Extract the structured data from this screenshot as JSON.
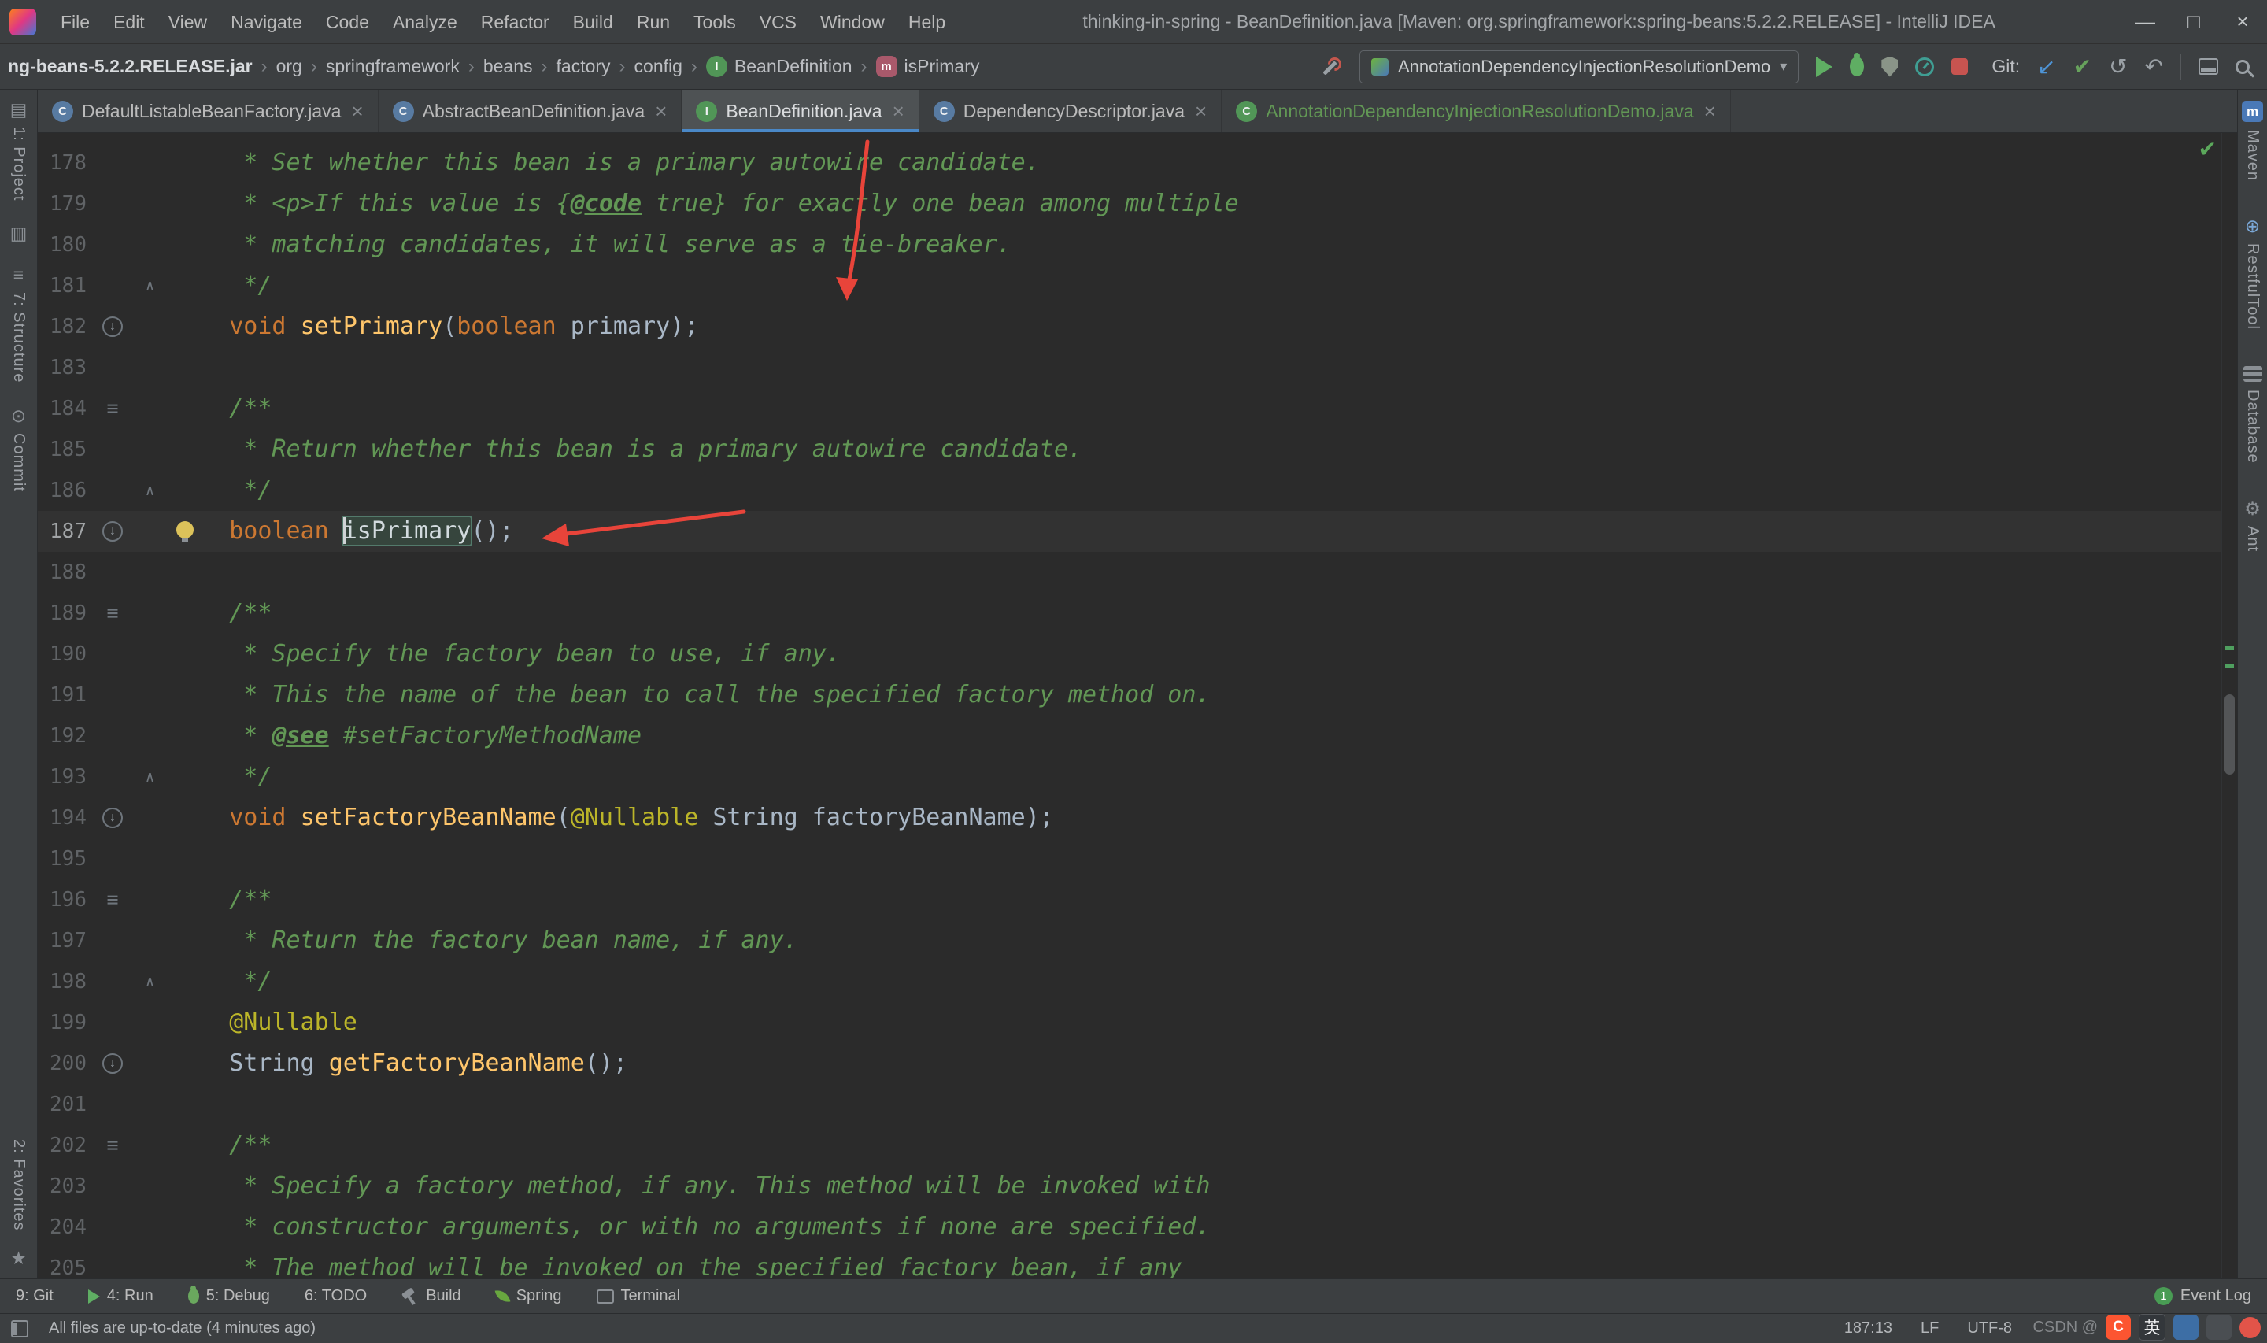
{
  "window": {
    "title": "thinking-in-spring - BeanDefinition.java [Maven: org.springframework:spring-beans:5.2.2.RELEASE] - IntelliJ IDEA",
    "menus": [
      "File",
      "Edit",
      "View",
      "Navigate",
      "Code",
      "Analyze",
      "Refactor",
      "Build",
      "Run",
      "Tools",
      "VCS",
      "Window",
      "Help"
    ],
    "controls": {
      "minimize": "—",
      "maximize": "□",
      "close": "×"
    }
  },
  "navbar": {
    "separator": "›",
    "crumbs": [
      {
        "label": "ng-beans-5.2.2.RELEASE.jar",
        "bold": true
      },
      {
        "label": "org"
      },
      {
        "label": "springframework"
      },
      {
        "label": "beans"
      },
      {
        "label": "factory"
      },
      {
        "label": "config"
      },
      {
        "label": "BeanDefinition",
        "icon": "interface"
      },
      {
        "label": "isPrimary",
        "icon": "method"
      }
    ],
    "run_config": "AnnotationDependencyInjectionResolutionDemo",
    "git_label": "Git:"
  },
  "tabbar": {
    "tabs": [
      {
        "label": "DefaultListableBeanFactory.java",
        "icon": "class"
      },
      {
        "label": "AbstractBeanDefinition.java",
        "icon": "class"
      },
      {
        "label": "BeanDefinition.java",
        "icon": "interface",
        "active": true
      },
      {
        "label": "DependencyDescriptor.java",
        "icon": "class"
      },
      {
        "label": "AnnotationDependencyInjectionResolutionDemo.java",
        "icon": "class",
        "vcs_new": true
      }
    ]
  },
  "left_strip": {
    "top": [
      {
        "label": "1: Project",
        "icon": "project"
      },
      {
        "icon": "folder"
      },
      {
        "label": "7: Structure",
        "icon": "structure"
      },
      {
        "label": "Commit",
        "icon": "commit"
      }
    ],
    "bottom": [
      {
        "label": "2: Favorites"
      },
      {
        "icon": "star"
      }
    ]
  },
  "right_strip": {
    "items": [
      {
        "label": "Maven",
        "icon": "maven"
      },
      {
        "label": "RestfulTool",
        "icon": "globe"
      },
      {
        "label": "Database",
        "icon": "database"
      },
      {
        "label": "Ant",
        "icon": "ant"
      }
    ]
  },
  "editor": {
    "lines": [
      {
        "n": 178,
        "t": [
          [
            "c",
            "     * Set whether this bean is a primary autowire candidate."
          ]
        ]
      },
      {
        "n": 179,
        "t": [
          [
            "c",
            "     * <p>If this value is {"
          ],
          [
            "ct",
            "@code"
          ],
          [
            "c",
            " true} for exactly one bean among multiple"
          ]
        ]
      },
      {
        "n": 180,
        "t": [
          [
            "c",
            "     * matching candidates, it will serve as a tie-breaker."
          ]
        ]
      },
      {
        "n": 181,
        "f": "end",
        "t": [
          [
            "c",
            "     */"
          ]
        ]
      },
      {
        "n": 182,
        "g": "impl",
        "t": [
          [
            "p",
            "    "
          ],
          [
            "k",
            "void"
          ],
          [
            "p",
            " "
          ],
          [
            "m",
            "setPrimary"
          ],
          [
            "p",
            "("
          ],
          [
            "k",
            "boolean"
          ],
          [
            "p",
            " primary);"
          ]
        ]
      },
      {
        "n": 183,
        "t": []
      },
      {
        "n": 184,
        "g": "doc",
        "t": [
          [
            "c",
            "    /**"
          ]
        ]
      },
      {
        "n": 185,
        "t": [
          [
            "c",
            "     * Return whether this bean is a primary autowire candidate."
          ]
        ]
      },
      {
        "n": 186,
        "f": "end",
        "t": [
          [
            "c",
            "     */"
          ]
        ]
      },
      {
        "n": 187,
        "g": "impl",
        "b": true,
        "cur": true,
        "t": [
          [
            "p",
            "    "
          ],
          [
            "k",
            "boolean"
          ],
          [
            "p",
            " "
          ],
          [
            "caret",
            ""
          ],
          [
            "sel",
            "isPrimary"
          ],
          [
            "p",
            "();"
          ]
        ]
      },
      {
        "n": 188,
        "t": []
      },
      {
        "n": 189,
        "g": "doc",
        "t": [
          [
            "c",
            "    /**"
          ]
        ]
      },
      {
        "n": 190,
        "t": [
          [
            "c",
            "     * Specify the factory bean to use, if any."
          ]
        ]
      },
      {
        "n": 191,
        "t": [
          [
            "c",
            "     * This the name of the bean to call the specified factory method on."
          ]
        ]
      },
      {
        "n": 192,
        "t": [
          [
            "c",
            "     * "
          ],
          [
            "ct",
            "@see"
          ],
          [
            "c",
            " #setFactoryMethodName"
          ]
        ]
      },
      {
        "n": 193,
        "f": "end",
        "t": [
          [
            "c",
            "     */"
          ]
        ]
      },
      {
        "n": 194,
        "g": "impl",
        "t": [
          [
            "p",
            "    "
          ],
          [
            "k",
            "void"
          ],
          [
            "p",
            " "
          ],
          [
            "m",
            "setFactoryBeanName"
          ],
          [
            "p",
            "("
          ],
          [
            "a",
            "@Nullable"
          ],
          [
            "p",
            " String factoryBeanName);"
          ]
        ]
      },
      {
        "n": 195,
        "t": []
      },
      {
        "n": 196,
        "g": "doc",
        "t": [
          [
            "c",
            "    /**"
          ]
        ]
      },
      {
        "n": 197,
        "t": [
          [
            "c",
            "     * Return the factory bean name, if any."
          ]
        ]
      },
      {
        "n": 198,
        "f": "end",
        "t": [
          [
            "c",
            "     */"
          ]
        ]
      },
      {
        "n": 199,
        "t": [
          [
            "p",
            "    "
          ],
          [
            "a",
            "@Nullable"
          ]
        ]
      },
      {
        "n": 200,
        "g": "impl",
        "t": [
          [
            "p",
            "    String "
          ],
          [
            "m",
            "getFactoryBeanName"
          ],
          [
            "p",
            "();"
          ]
        ]
      },
      {
        "n": 201,
        "t": []
      },
      {
        "n": 202,
        "g": "doc",
        "t": [
          [
            "c",
            "    /**"
          ]
        ]
      },
      {
        "n": 203,
        "t": [
          [
            "c",
            "     * Specify a factory method, if any. This method will be invoked with"
          ]
        ]
      },
      {
        "n": 204,
        "t": [
          [
            "c",
            "     * constructor arguments, or with no arguments if none are specified."
          ]
        ]
      },
      {
        "n": 205,
        "t": [
          [
            "c",
            "     * The method will be invoked on the specified factory bean, if any"
          ]
        ]
      }
    ]
  },
  "toolbar_bottom": {
    "items": [
      {
        "label": "9: Git"
      },
      {
        "label": "4: Run",
        "icon": "run"
      },
      {
        "label": "5: Debug",
        "icon": "debug"
      },
      {
        "label": "6: TODO"
      },
      {
        "label": "Build",
        "icon": "build"
      },
      {
        "label": "Spring",
        "icon": "spring"
      },
      {
        "label": "Terminal",
        "icon": "terminal"
      }
    ],
    "right": {
      "badge": "1",
      "label": "Event Log"
    }
  },
  "statusbar": {
    "message": "All files are up-to-date (4 minutes ago)",
    "position": "187:13",
    "line_ending": "LF",
    "encoding": "UTF-8"
  },
  "watermark": {
    "text": "CSDN @",
    "ime": "英"
  },
  "colors": {
    "accent_blue": "#4a88c7",
    "vcs_green": "#629755",
    "arrow_red": "#e8443a"
  }
}
